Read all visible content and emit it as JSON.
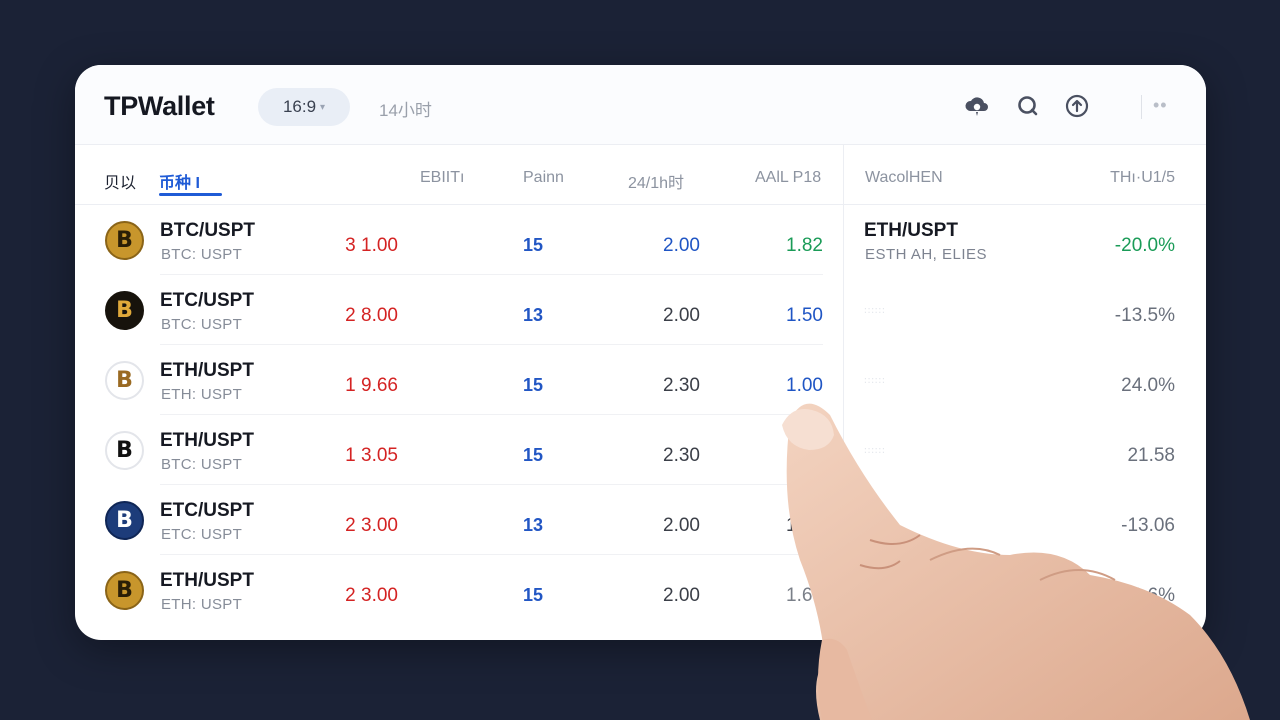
{
  "app": {
    "title": "TPWallet"
  },
  "toolbar": {
    "ratio_label": "16:9",
    "caret": "▾",
    "timeframe": "14小时",
    "more": "••"
  },
  "icons": [
    "cloud-icon",
    "search-icon",
    "upload-icon",
    "more-icon"
  ],
  "table": {
    "tabs": [
      "贝以",
      "币种 I"
    ],
    "columns": [
      "EBIITı",
      "Painn",
      "24/1h时",
      "AAlL P18"
    ],
    "rows": [
      {
        "pair": "BTC/USPT",
        "sub": "BTC: USPT",
        "price": "3 1.00",
        "pairs": "15",
        "h24": "2.00",
        "h24_color": "#1f55c4",
        "avg": "1.82",
        "avg_color": "#1a9b57",
        "coin_bg": "#c8962c",
        "coin_fg": "#2a1e06",
        "coin_border": "#8a6418"
      },
      {
        "pair": "ETC/USPT",
        "sub": "BTC: USPT",
        "price": "2 8.00",
        "pairs": "13",
        "h24": "2.00",
        "h24_color": "#3b3f48",
        "avg": "1.50",
        "avg_color": "#1f55c4",
        "coin_bg": "#17130c",
        "coin_fg": "#e0a93a",
        "coin_border": "#17130c"
      },
      {
        "pair": "ETH/USPT",
        "sub": "ETH: USPT",
        "price": "1 9.66",
        "pairs": "15",
        "h24": "2.30",
        "h24_color": "#3b3f48",
        "avg": "1.00",
        "avg_color": "#1f55c4",
        "coin_bg": "#ffffff",
        "coin_fg": "#9a6a22",
        "coin_border": "#e3e5ea"
      },
      {
        "pair": "ETH/USPT",
        "sub": "BTC: USPT",
        "price": "1 3.05",
        "pairs": "15",
        "h24": "2.30",
        "h24_color": "#3b3f48",
        "avg": "",
        "avg_color": "#3b3f48",
        "coin_bg": "#ffffff",
        "coin_fg": "#111111",
        "coin_border": "#e3e5ea"
      },
      {
        "pair": "ETC/USPT",
        "sub": "ETC: USPT",
        "price": "2 3.00",
        "pairs": "13",
        "h24": "2.00",
        "h24_color": "#3b3f48",
        "avg": "1.60",
        "avg_color": "#3b3f48",
        "coin_bg": "#1d3c7a",
        "coin_fg": "#ffffff",
        "coin_border": "#0f2656"
      },
      {
        "pair": "ETH/USPT",
        "sub": "ETH: USPT",
        "price": "2 3.00",
        "pairs": "15",
        "h24": "2.00",
        "h24_color": "#3b3f48",
        "avg": "1.65",
        "avg_color": "#7a7f88",
        "coin_bg": "#c8962c",
        "coin_fg": "#2a1e06",
        "coin_border": "#8a6418"
      }
    ]
  },
  "side_panel": {
    "columns": [
      "WacolHEN",
      "THı·U1/5"
    ],
    "rows": [
      {
        "pair": "ETH/USPT",
        "sub": "ESTH AH, ELIES",
        "faint": "",
        "value": "-20.0%",
        "value_color": "#1a9b57"
      },
      {
        "pair": "",
        "sub": "",
        "faint": "∶∶∶∶∶∶",
        "value": "-13.5%",
        "value_color": "#6a707c"
      },
      {
        "pair": "",
        "sub": "",
        "faint": "∶∶∶∶∶∶",
        "value": "24.0%",
        "value_color": "#6a707c"
      },
      {
        "pair": "",
        "sub": "",
        "faint": "∶∶∶∶∶∶",
        "value": "21.58",
        "value_color": "#6a707c"
      },
      {
        "pair": "",
        "sub": "",
        "faint": "",
        "value": "-13.06",
        "value_color": "#6a707c"
      },
      {
        "pair": "",
        "sub": "",
        "faint": "",
        "value": "39.6%",
        "value_color": "#6a707c"
      }
    ]
  }
}
